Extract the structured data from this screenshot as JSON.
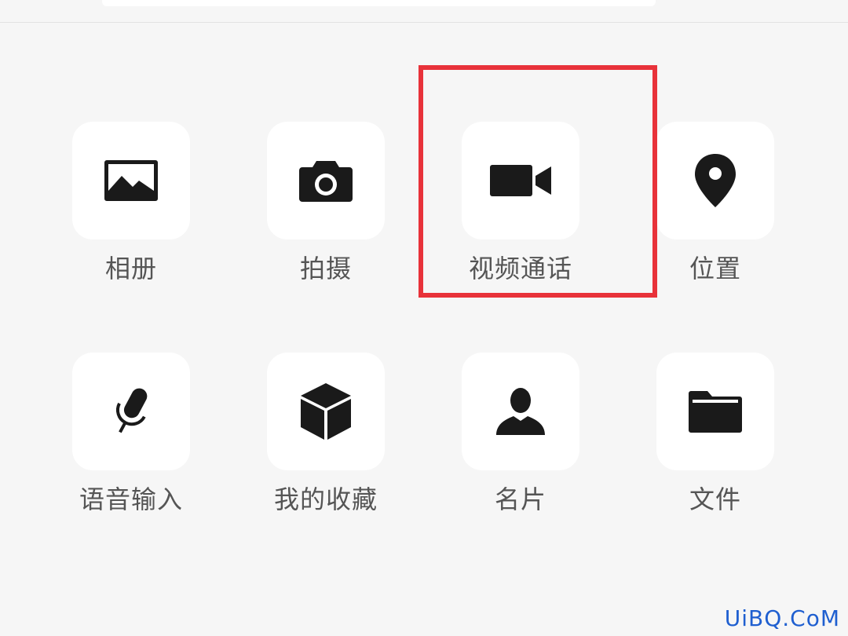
{
  "panel": {
    "items": [
      {
        "label": "相册",
        "icon": "photo-album-icon"
      },
      {
        "label": "拍摄",
        "icon": "camera-icon"
      },
      {
        "label": "视频通话",
        "icon": "video-camera-icon"
      },
      {
        "label": "位置",
        "icon": "location-pin-icon"
      },
      {
        "label": "语音输入",
        "icon": "microphone-icon"
      },
      {
        "label": "我的收藏",
        "icon": "cube-icon"
      },
      {
        "label": "名片",
        "icon": "person-icon"
      },
      {
        "label": "文件",
        "icon": "folder-icon"
      }
    ]
  },
  "colors": {
    "highlight": "#e8323a",
    "watermark": "#1f5fd0",
    "icon": "#1a1a1a",
    "label": "#555555"
  },
  "watermark": {
    "text": "UiBQ.CoM"
  }
}
